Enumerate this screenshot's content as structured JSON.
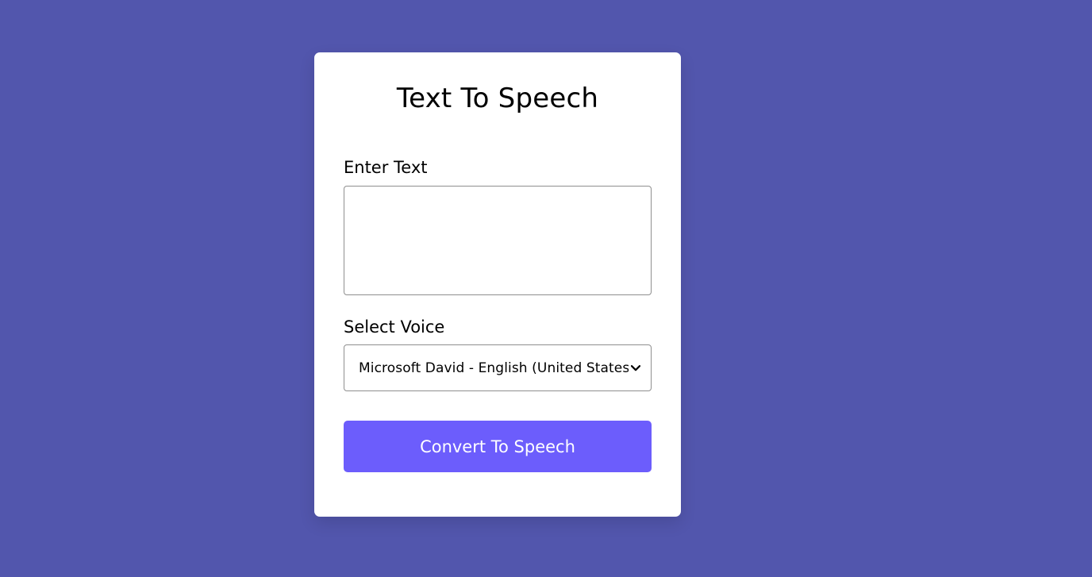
{
  "app": {
    "title": "Text To Speech"
  },
  "form": {
    "text_label": "Enter Text",
    "text_value": "",
    "voice_label": "Select Voice",
    "voice_selected": "Microsoft David - English (United States)",
    "submit_label": "Convert To Speech"
  },
  "colors": {
    "background": "#5256ad",
    "card": "#ffffff",
    "button": "#6c5dfc",
    "button_text": "#ffffff"
  },
  "icons": {
    "select_arrow": "chevron-down-icon"
  }
}
